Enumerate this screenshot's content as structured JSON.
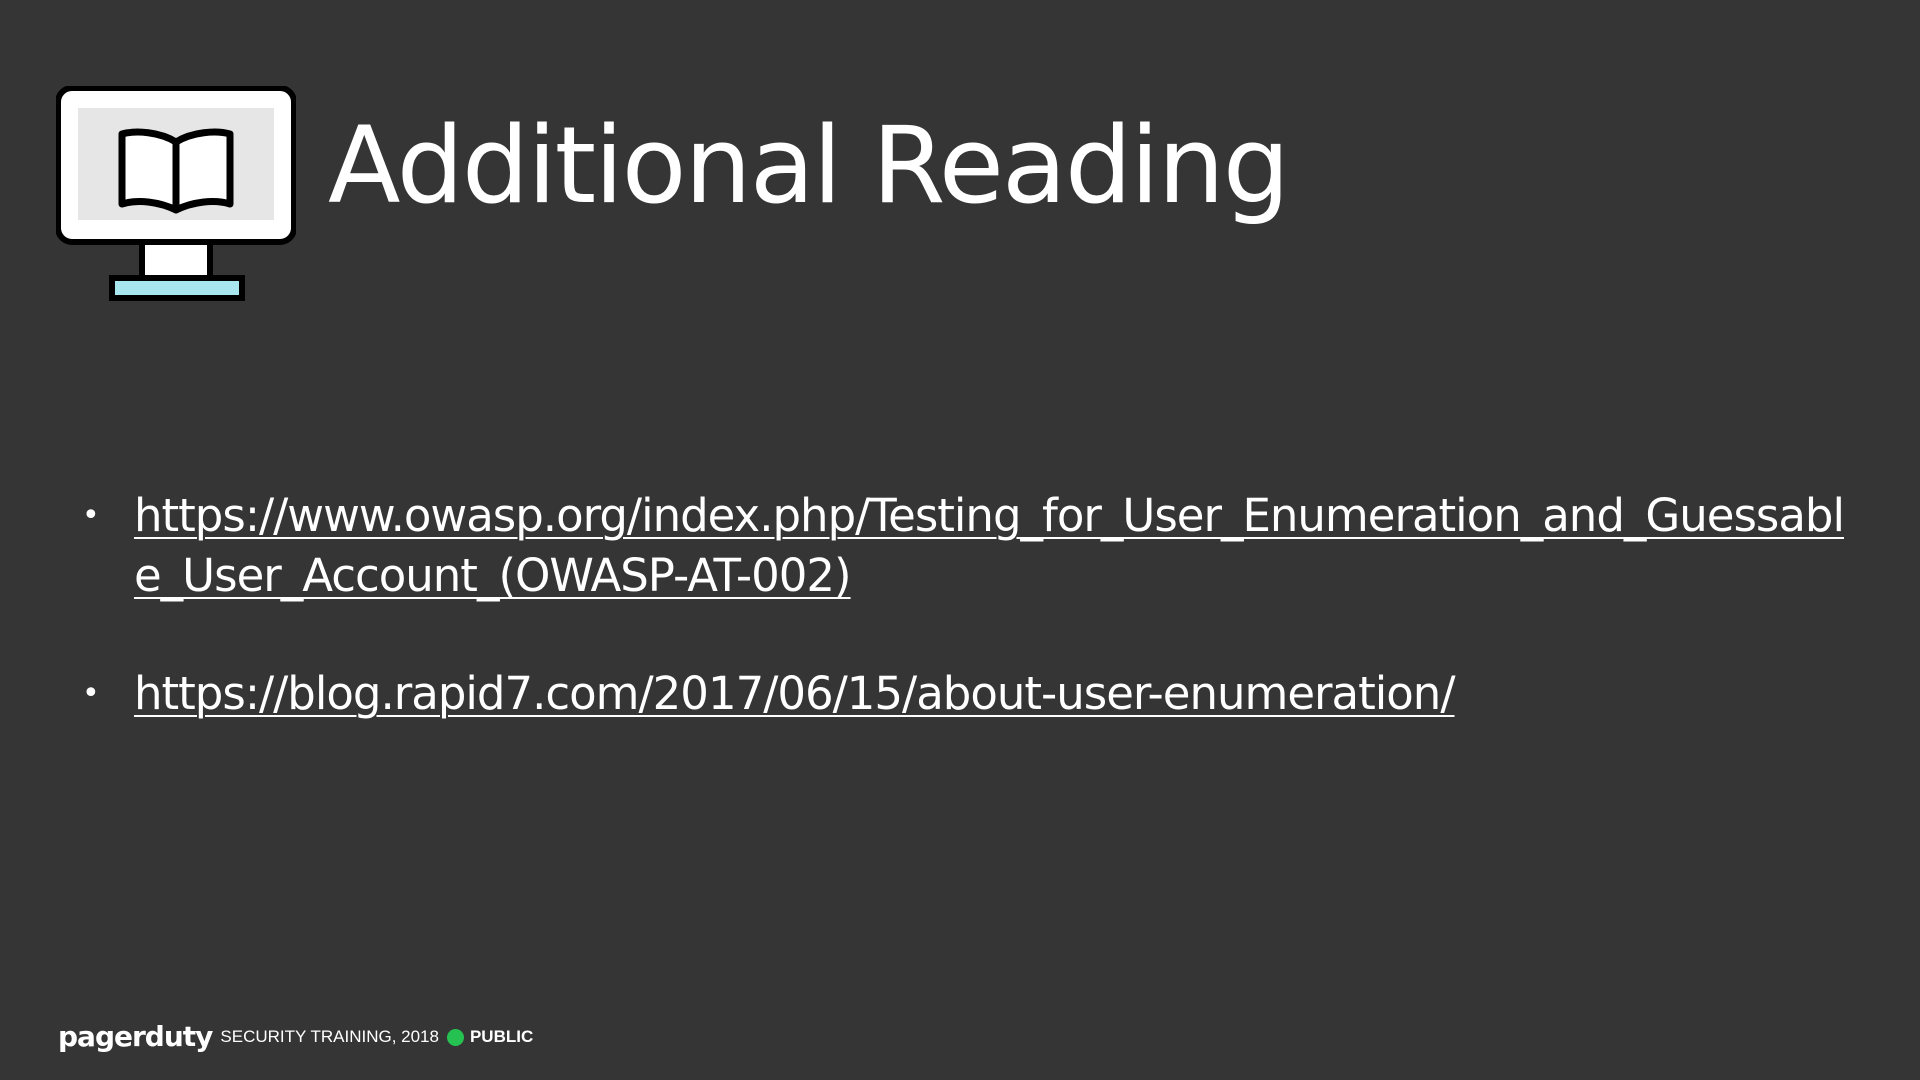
{
  "slide": {
    "title": "Additional Reading",
    "icon": "monitor-book-icon",
    "links": [
      {
        "text": "https://www.owasp.org/index.php/Testing_for_User_Enumeration_and_Guessable_User_Account_(OWASP-AT-002)"
      },
      {
        "text": "https://blog.rapid7.com/2017/06/15/about-user-enumeration/"
      }
    ],
    "bullet": "•"
  },
  "footer": {
    "brand": "pagerduty",
    "text": "SECURITY TRAINING, 2018",
    "badge": "PUBLIC"
  },
  "colors": {
    "background": "#353535",
    "text": "#ffffff",
    "status_green": "#25c151",
    "monitor_screen": "#e6e6e6",
    "monitor_stand_accent": "#a8e6f0"
  }
}
